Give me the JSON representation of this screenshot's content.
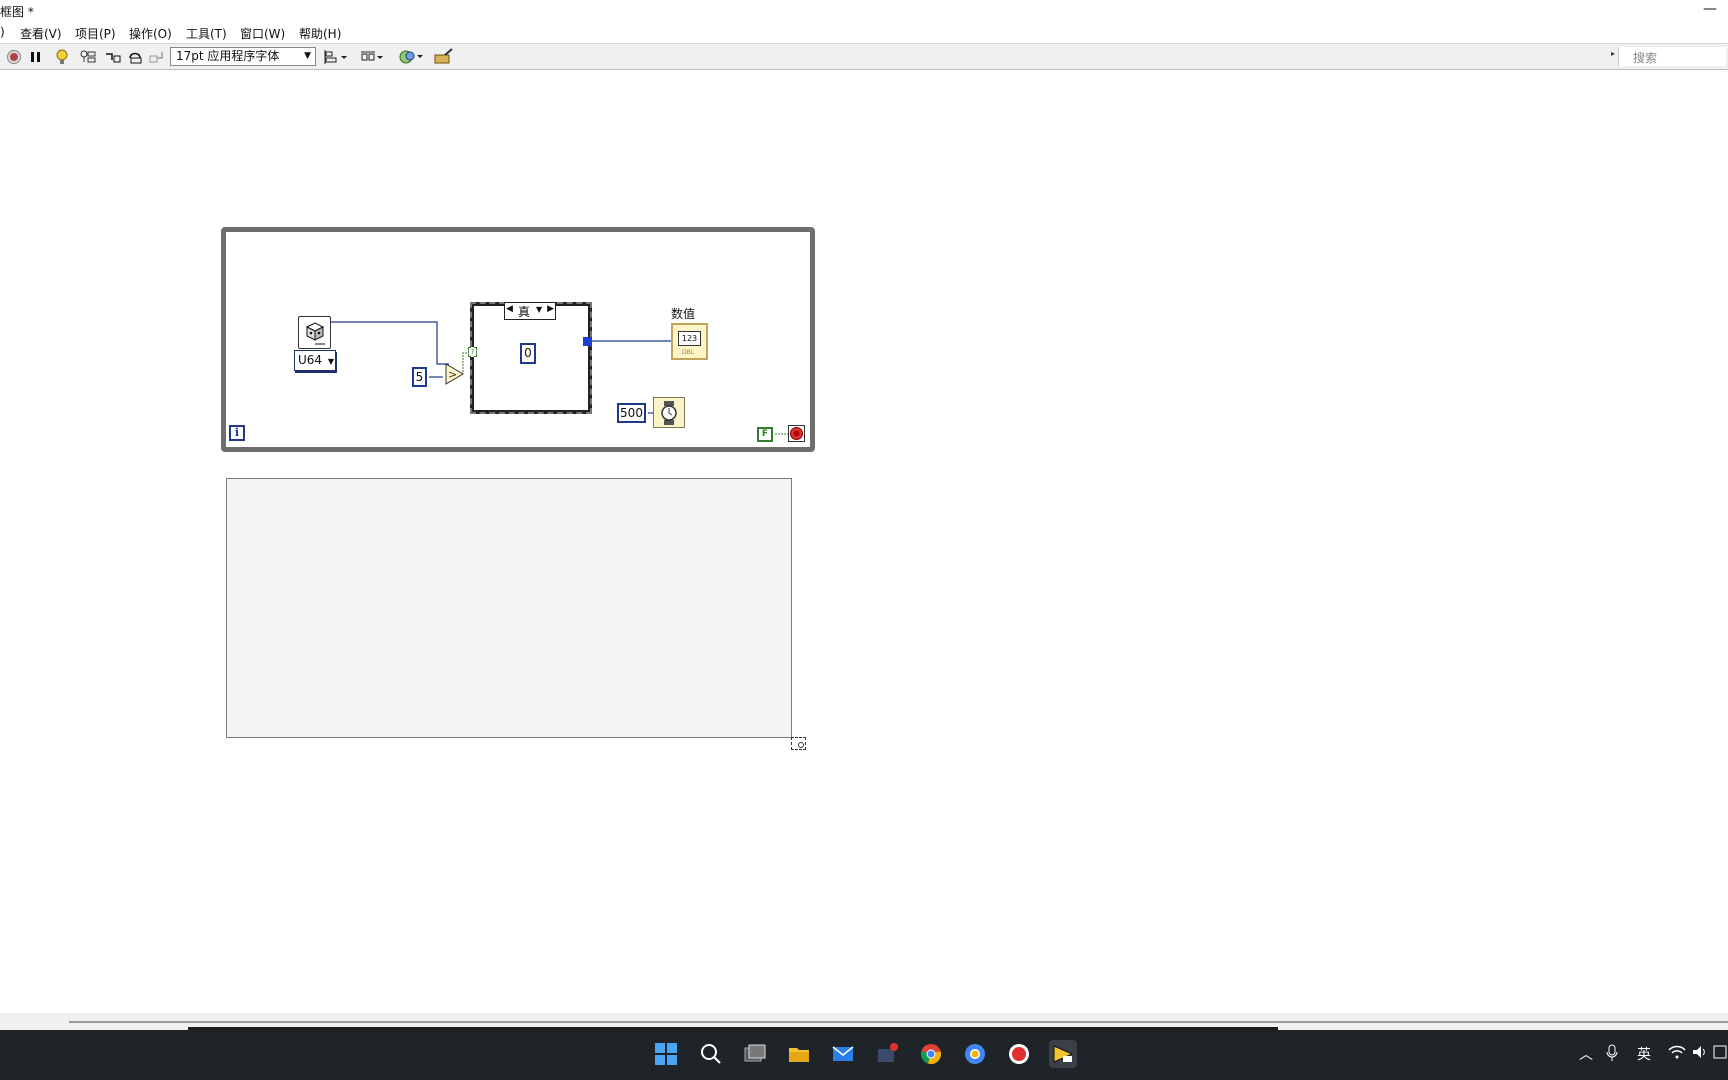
{
  "window": {
    "title": "框图 *",
    "minimize_glyph": "—"
  },
  "menu": {
    "items": [
      {
        "label": ")"
      },
      {
        "label": "查看(V)"
      },
      {
        "label": "项目(P)"
      },
      {
        "label": "操作(O)"
      },
      {
        "label": "工具(T)"
      },
      {
        "label": "窗口(W)"
      },
      {
        "label": "帮助(H)"
      }
    ]
  },
  "toolbar": {
    "font_dropdown": "17pt 应用程序字体",
    "search_placeholder": "搜索"
  },
  "diagram": {
    "loop_iteration_label": "i",
    "numeric_type": "U64",
    "compare_constant": "5",
    "case_selector_value": "真",
    "case_bool_input": "?",
    "case_output_constant": "0",
    "indicator_label": "数值",
    "indicator_display": "123",
    "indicator_type": "DBL",
    "wait_constant": "500",
    "stop_constant": "F"
  },
  "colors": {
    "taskbar": "#1f2429",
    "accent_blue": "#1e3a8a",
    "indicator_fill": "#fdf4c8"
  },
  "taskbar": {
    "icons": [
      "windows-start-icon",
      "search-icon",
      "task-view-icon",
      "file-explorer-icon",
      "mail-icon",
      "media-icon",
      "chrome-icon",
      "chrome-alt-icon",
      "record-icon",
      "labview-icon"
    ],
    "tray": {
      "ime_label": "英"
    }
  }
}
